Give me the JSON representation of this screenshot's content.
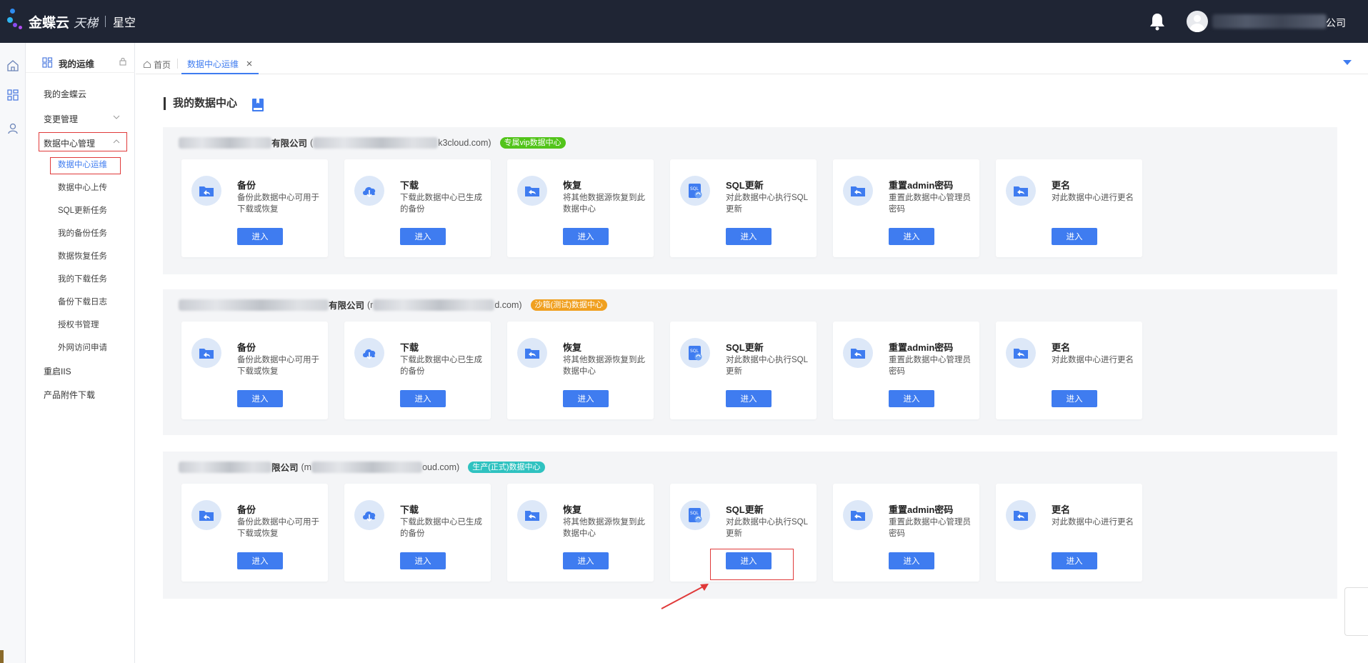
{
  "header": {
    "brand": "金蝶云",
    "brand_sub": "天梯",
    "product": "星空",
    "company_tail": "公司"
  },
  "sidebar": {
    "title": "我的运维",
    "items": [
      {
        "label": "我的金蝶云"
      },
      {
        "label": "变更管理"
      },
      {
        "label": "数据中心管理"
      },
      {
        "label": "重启IIS"
      },
      {
        "label": "产品附件下载"
      }
    ],
    "subitems": [
      {
        "label": "数据中心运维"
      },
      {
        "label": "数据中心上传"
      },
      {
        "label": "SQL更新任务"
      },
      {
        "label": "我的备份任务"
      },
      {
        "label": "数据恢复任务"
      },
      {
        "label": "我的下载任务"
      },
      {
        "label": "备份下载日志"
      },
      {
        "label": "授权书管理"
      },
      {
        "label": "外网访问申请"
      }
    ]
  },
  "tabs": [
    {
      "label": "首页"
    },
    {
      "label": "数据中心运维"
    }
  ],
  "page": {
    "title": "我的数据中心"
  },
  "sections": [
    {
      "name_tail": "有限公司",
      "url_head": "(",
      "url_tail": "k3cloud.com)",
      "badge": "专属vip数据中心",
      "badge_color": "#52c41a"
    },
    {
      "name_tail": "有限公司",
      "url_head": "(r",
      "url_tail": "d.com)",
      "badge": "沙箱(测试)数据中心",
      "badge_color": "#f0a020"
    },
    {
      "name_tail": "限公司",
      "url_head": "(m",
      "url_tail": "oud.com)",
      "badge": "生产(正式)数据中心",
      "badge_color": "#2fc2c0"
    }
  ],
  "cards": [
    {
      "title": "备份",
      "desc": "备份此数据中心可用于下载或恢复",
      "icon": "folder-backup-icon"
    },
    {
      "title": "下载",
      "desc": "下载此数据中心已生成的备份",
      "icon": "cloud-download-icon"
    },
    {
      "title": "恢复",
      "desc": "将其他数据源恢复到此数据中心",
      "icon": "folder-restore-icon"
    },
    {
      "title": "SQL更新",
      "desc": "对此数据中心执行SQL更新",
      "icon": "sql-update-icon"
    },
    {
      "title": "重置admin密码",
      "desc": "重置此数据中心管理员密码",
      "icon": "folder-reset-icon"
    },
    {
      "title": "更名",
      "desc": "对此数据中心进行更名",
      "icon": "folder-rename-icon"
    }
  ],
  "button_label": "进入",
  "colors": {
    "topbar": "#1f2534",
    "accent": "#3f7cf0",
    "highlight": "#e03a3a"
  }
}
